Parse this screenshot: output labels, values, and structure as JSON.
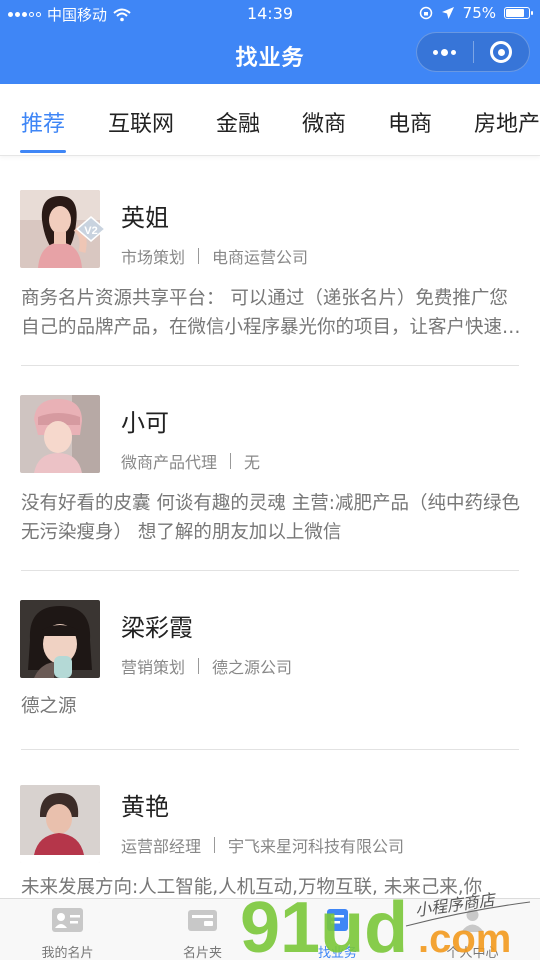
{
  "status_bar": {
    "carrier": "中国移动",
    "time": "14:39",
    "battery_percent": "75%",
    "battery_level": 0.75
  },
  "nav": {
    "title": "找业务",
    "more_icon": "more-dots-icon",
    "close_icon": "target-close-icon"
  },
  "tabs": [
    {
      "label": "推荐",
      "active": true
    },
    {
      "label": "互联网",
      "active": false
    },
    {
      "label": "金融",
      "active": false
    },
    {
      "label": "微商",
      "active": false
    },
    {
      "label": "电商",
      "active": false
    },
    {
      "label": "房地产",
      "active": false
    }
  ],
  "cards": [
    {
      "name": "英姐",
      "position": "市场策划",
      "company": "电商运营公司",
      "badge": "V2",
      "description": "商务名片资源共享平台： 可以通过（递张名片）免费推广您自己的品牌产品，在微信小程序暴光你的项目，让客户快速找到你"
    },
    {
      "name": "小可",
      "position": "微商产品代理",
      "company": "无",
      "description": "没有好看的皮囊 何谈有趣的灵魂 主营:减肥产品（纯中药绿色无污染瘦身） 想了解的朋友加以上微信"
    },
    {
      "name": "梁彩霞",
      "position": "营销策划",
      "company": "德之源公司",
      "description": "德之源"
    },
    {
      "name": "黄艳",
      "position": "运营部经理",
      "company": "宇飞来星河科技有限公司",
      "description": "未来发展方向:人工智能,人机互动,万物互联, 未来己来,你"
    }
  ],
  "bottom_tabs": [
    {
      "label": "我的名片",
      "icon": "id-card-icon",
      "active": false
    },
    {
      "label": "名片夹",
      "icon": "card-holder-icon",
      "active": false
    },
    {
      "label": "找业务",
      "icon": "find-business-icon",
      "active": true
    },
    {
      "label": "个人中心",
      "icon": "person-icon",
      "active": false
    }
  ],
  "colors": {
    "accent": "#3f86f6",
    "text_primary": "#222222",
    "text_secondary": "#888888",
    "watermark_green": "#7bc83a",
    "watermark_orange": "#f39a1e"
  },
  "watermark": {
    "logo_text": "91ud.com",
    "tagline": "小程序商店"
  }
}
